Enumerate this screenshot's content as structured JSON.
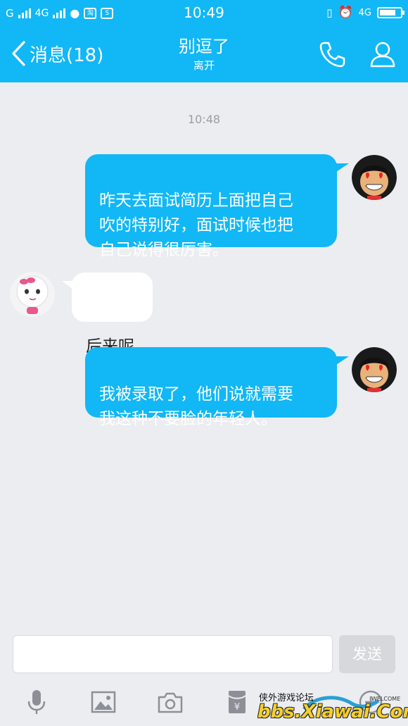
{
  "status_bar": {
    "carrier": "G",
    "network": "4G",
    "network2": "4G",
    "app_icon_1": "淘",
    "app_icon_2": "S",
    "time": "10:49"
  },
  "header": {
    "back_label": "消息(18)",
    "title": "别逗了",
    "subtitle": "离开"
  },
  "chat": {
    "timestamp": "10:48",
    "messages": [
      {
        "direction": "out",
        "text": "昨天去面试简历上面把自己\n吹的特别好，面试时候也把\n自己说得很厉害。"
      },
      {
        "direction": "in",
        "text": "后来呢"
      },
      {
        "direction": "out",
        "text": "我被录取了，他们说就需要\n我这种不要脸的年轻人。"
      }
    ]
  },
  "input_bar": {
    "input_value": "",
    "send_label": "发送"
  },
  "watermark": {
    "name": "侠外游戏论坛",
    "url": "bbs.Xiawai.Com",
    "welcome": "WELCOME"
  },
  "colors": {
    "accent": "#12b7f5",
    "background": "#ebedf0"
  }
}
